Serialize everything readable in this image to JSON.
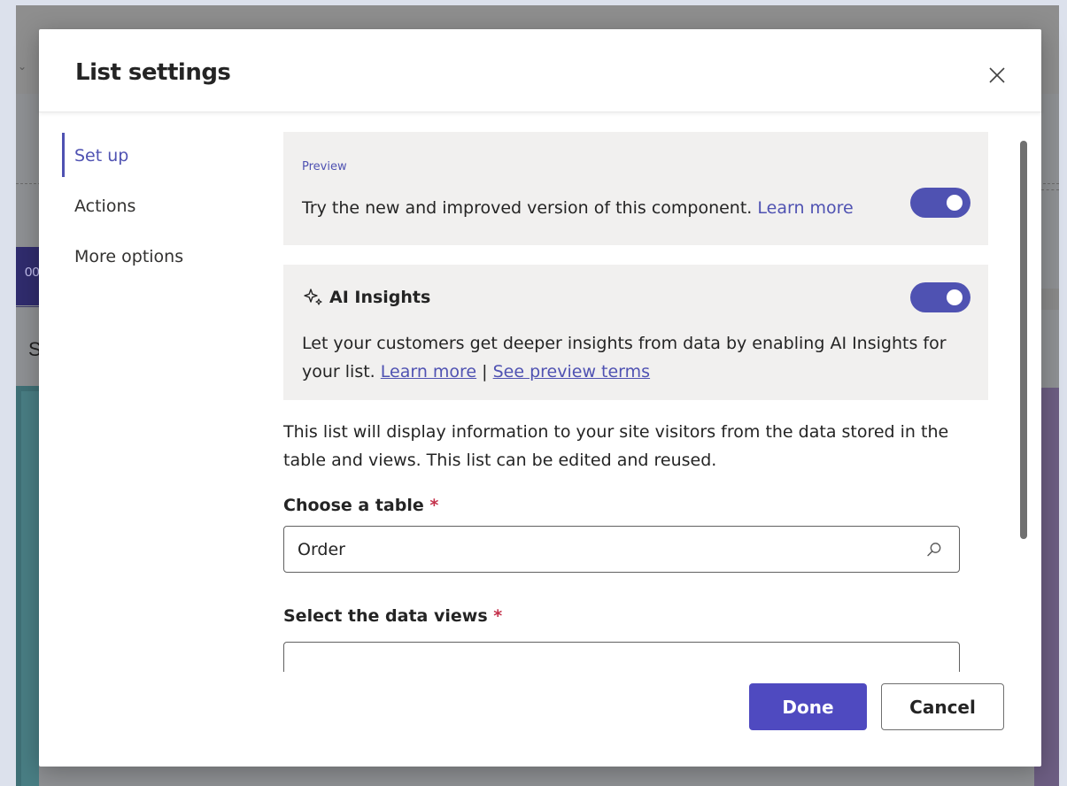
{
  "background": {
    "toolbar_glyph": "⌄",
    "partial_button_label": "00",
    "partial_letter": "S"
  },
  "dialog": {
    "title": "List settings",
    "close_icon": "close-icon"
  },
  "nav": {
    "items": [
      {
        "label": "Set up",
        "active": true
      },
      {
        "label": "Actions",
        "active": false
      },
      {
        "label": "More options",
        "active": false
      }
    ]
  },
  "preview_card": {
    "tag": "Preview",
    "text": "Try the new and improved version of this component.",
    "link": "Learn more",
    "toggle_on": true
  },
  "ai_card": {
    "icon": "sparkle-icon",
    "title": "AI Insights",
    "description": "Let your customers get deeper insights from data by enabling AI Insights for your list.",
    "learn_link": "Learn more",
    "separator": "|",
    "terms_link": "See preview terms",
    "toggle_on": true
  },
  "form": {
    "description": "This list will display information to your site visitors from the data stored in the table and views. This list can be edited and reused.",
    "table_label": "Choose a table",
    "required_marker": "*",
    "table_value": "Order",
    "views_label": "Select the data views",
    "views_value": ""
  },
  "footer": {
    "done_label": "Done",
    "cancel_label": "Cancel"
  },
  "colors": {
    "accent": "#4f52b2",
    "primary_button": "#4f4ac0",
    "card_bg": "#f1f0ef",
    "required": "#c4314b"
  }
}
